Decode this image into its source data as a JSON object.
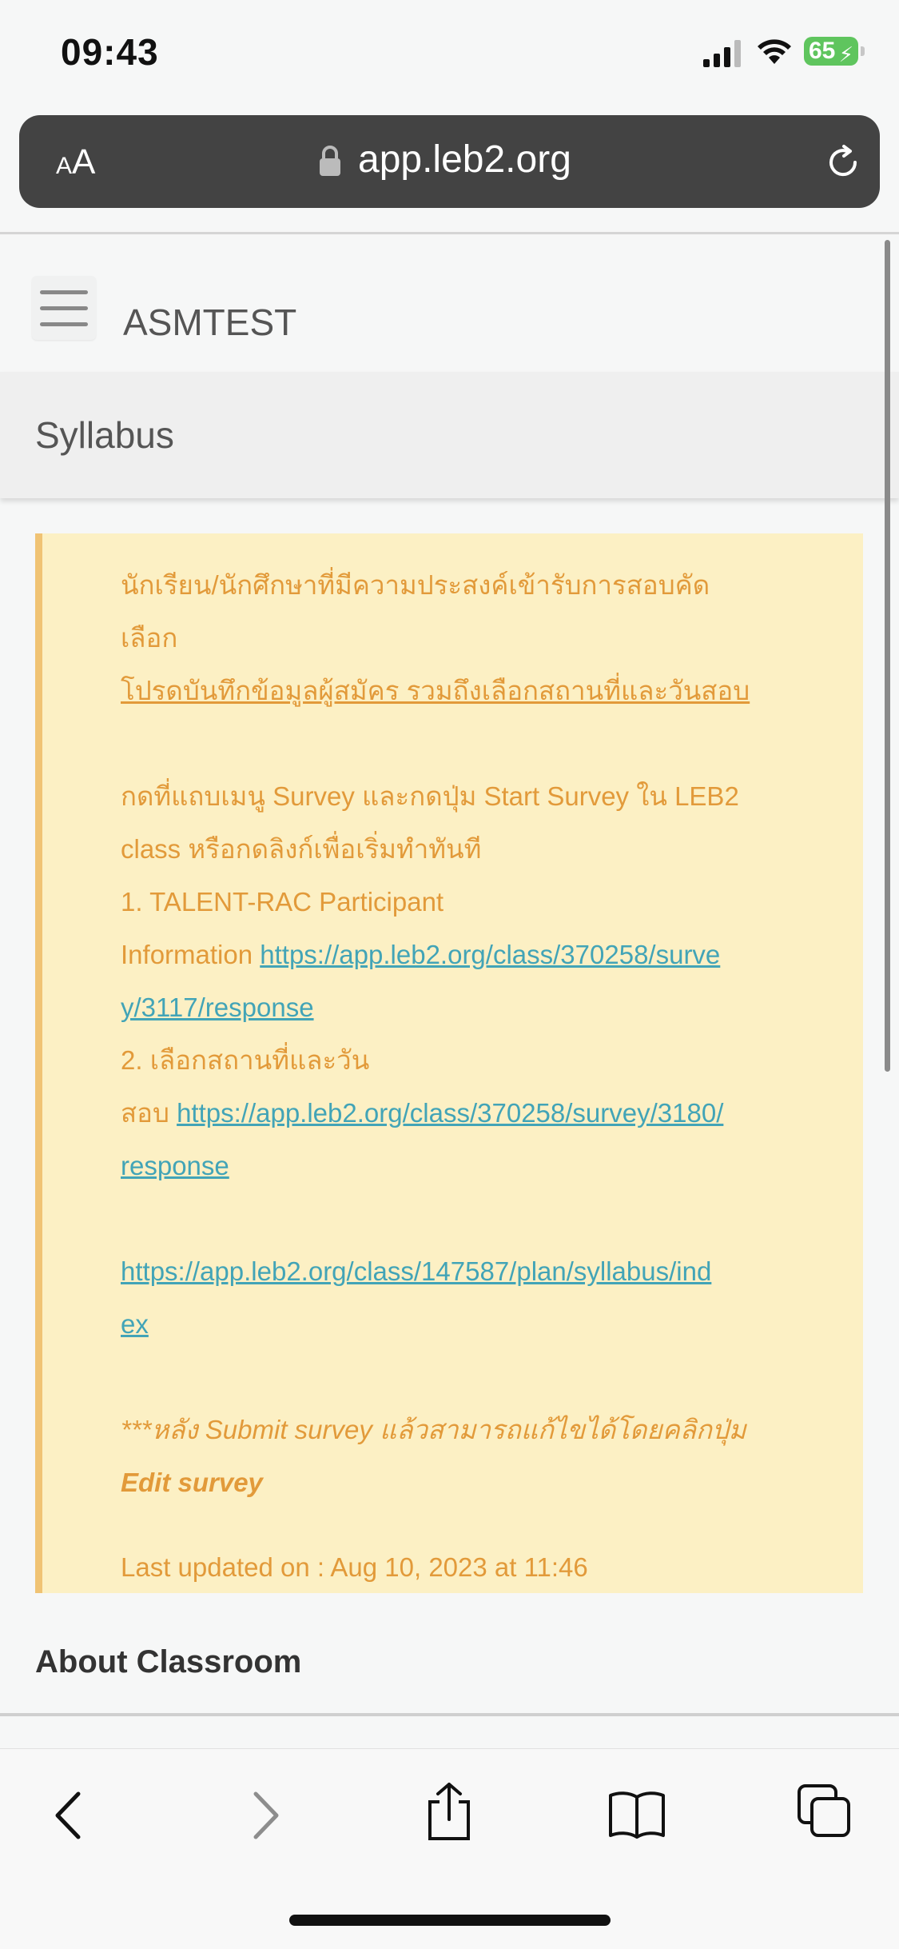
{
  "status_bar": {
    "time": "09:43",
    "battery": "65"
  },
  "browser": {
    "text_size_label": "AA",
    "url": "app.leb2.org"
  },
  "app": {
    "title": "ASMTEST",
    "section": "Syllabus"
  },
  "notice": {
    "line1": "นักเรียน/นักศึกษาที่มีความประสงค์เข้ารับการสอบคัดเลือก",
    "line2": "โปรดบันทึกข้อมูลผู้สมัคร รวมถึงเลือกสถานที่และวันสอบ",
    "line3": "กดที่แถบเมนู Survey และกดปุ่ม Start Survey ใน LEB2",
    "line4": "class หรือกดลิงก์เพื่อเริ่มทำทันที",
    "item1_title": "1. TALENT-RAC Participant",
    "item1_prefix": "Information ",
    "item1_link_a": "https://app.leb2.org/class/370258/surve",
    "item1_link_b": "y/3117/response",
    "item2_title": "2. เลือกสถานที่และวัน",
    "item2_prefix": "สอบ ",
    "item2_link_a": "https://app.leb2.org/class/370258/survey/3180/",
    "item2_link_b": "response",
    "syllabus_link_a": "https://app.leb2.org/class/147587/plan/syllabus/ind",
    "syllabus_link_b": "ex",
    "note_line1": "***หลัง Submit survey แล้วสามารถแก้ไขได้โดยคลิกปุ่ม",
    "note_line2": "Edit survey",
    "updated": "Last updated on : Aug 10, 2023 at 11:46"
  },
  "about_heading": "About Classroom",
  "toolbar": {
    "icons": [
      "back-icon",
      "forward-icon",
      "share-icon",
      "bookmarks-icon",
      "tabs-icon"
    ]
  }
}
